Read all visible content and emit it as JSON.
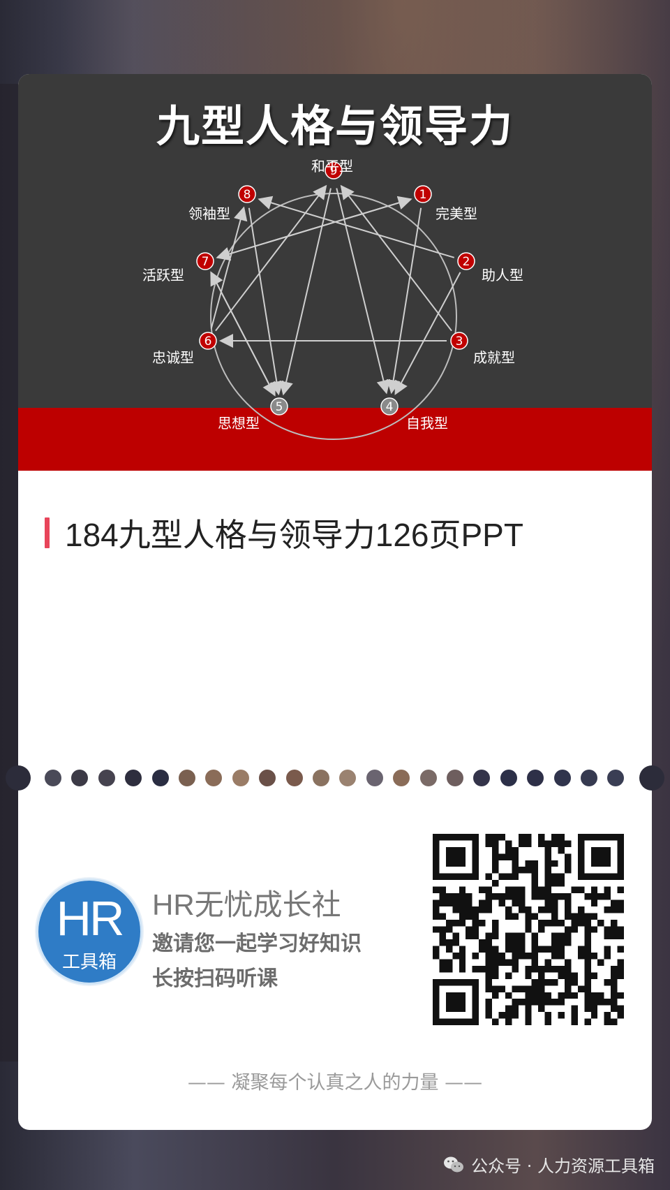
{
  "banner": {
    "title": "九型人格与领导力",
    "types": [
      {
        "num": "9",
        "name": "和平型"
      },
      {
        "num": "1",
        "name": "完美型"
      },
      {
        "num": "2",
        "name": "助人型"
      },
      {
        "num": "3",
        "name": "成就型"
      },
      {
        "num": "4",
        "name": "自我型"
      },
      {
        "num": "5",
        "name": "思想型"
      },
      {
        "num": "6",
        "name": "忠诚型"
      },
      {
        "num": "7",
        "name": "活跃型"
      },
      {
        "num": "8",
        "name": "领袖型"
      }
    ],
    "colors": {
      "dark": "#3a3a3a",
      "red": "#bd0000",
      "badge": "#c00000",
      "badge_gray": "#8a8a8a"
    }
  },
  "article": {
    "title": "184九型人格与领导力126页PPT",
    "accent_color": "#e8455a"
  },
  "brand": {
    "avatar_main": "HR",
    "avatar_sub": "工具箱",
    "name": "HR无忧成长社",
    "line1": "邀请您一起学习好知识",
    "line2": "长按扫码听课",
    "qr_icon": "qr-code"
  },
  "slogan": "—— 凝聚每个认真之人的力量 ——",
  "footer": {
    "icon": "wechat-icon",
    "text": "公众号 · 人力资源工具箱"
  }
}
